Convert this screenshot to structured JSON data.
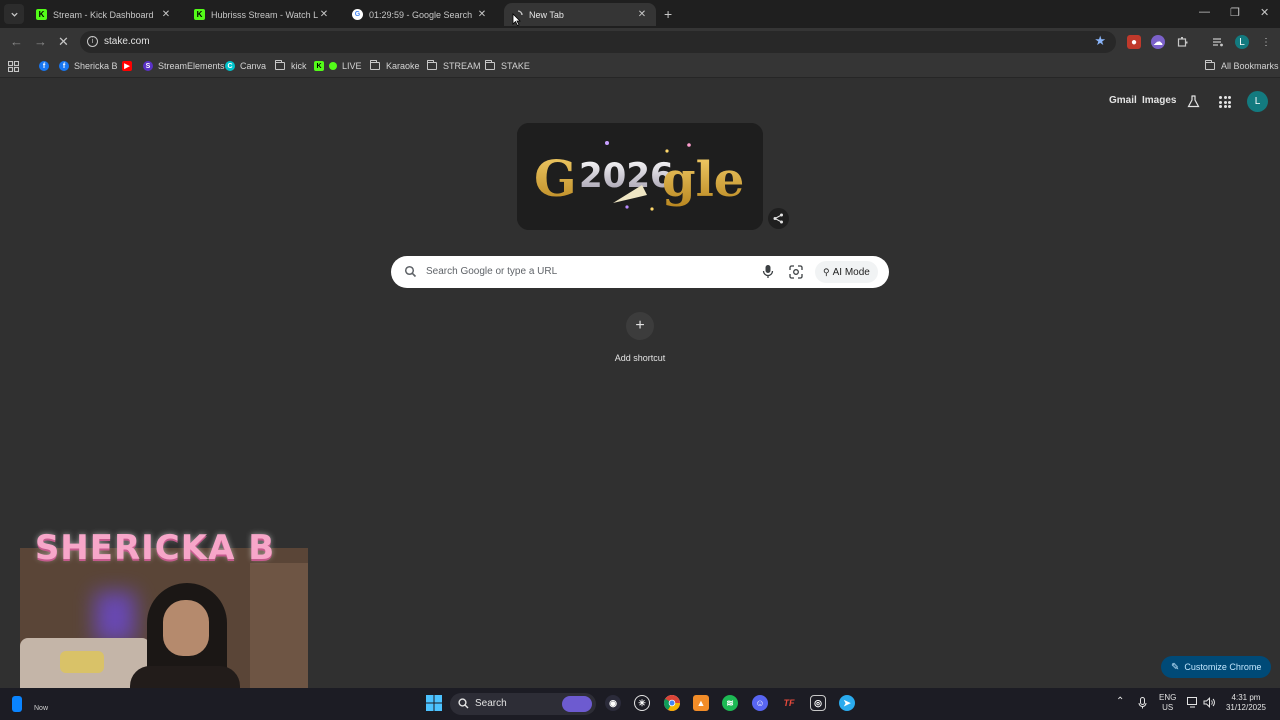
{
  "tabs": [
    {
      "title": "Stream - Kick Dashboard",
      "favicon": "kick-icon"
    },
    {
      "title": "Hubrisss Stream - Watch Live o",
      "favicon": "kick-icon"
    },
    {
      "title": "01:29:59 - Google Search",
      "favicon": "google-icon"
    },
    {
      "title": "New Tab",
      "favicon": "loading-icon",
      "active": true
    }
  ],
  "address_bar": {
    "url": "stake.com"
  },
  "bookmarks": {
    "items": [
      {
        "label": "Shericka B",
        "icon": "facebook-icon"
      },
      {
        "label": "",
        "icon": "youtube-icon"
      },
      {
        "label": "StreamElements",
        "icon": "streamelements-icon"
      },
      {
        "label": "Canva",
        "icon": "canva-icon"
      },
      {
        "label": "kick",
        "icon": "folder-icon"
      },
      {
        "label": "LIVE",
        "icon": "kick-icon"
      },
      {
        "label": "Karaoke",
        "icon": "folder-icon"
      },
      {
        "label": "STREAM",
        "icon": "folder-icon"
      },
      {
        "label": "STAKE",
        "icon": "folder-icon"
      }
    ],
    "all_bookmarks": "All Bookmarks"
  },
  "header_links": {
    "gmail": "Gmail",
    "images": "Images",
    "avatar_letter": "L"
  },
  "search": {
    "placeholder": "Search Google or type a URL",
    "ai_mode": "AI Mode"
  },
  "shortcuts": {
    "add_label": "Add shortcut"
  },
  "customize": {
    "label": "Customize Chrome"
  },
  "doodle": {
    "text": "Google 2026",
    "year": "2026"
  },
  "webcam": {
    "name": "SHERICKA B"
  },
  "taskbar": {
    "search_label": "Search",
    "now_label": "Now",
    "lang_top": "ENG",
    "lang_bottom": "US",
    "time": "4:31 pm",
    "date": "31/12/2025"
  },
  "colors": {
    "accent": "#8ab4f8",
    "kick": "#53fc18",
    "customize_bg": "#004a77"
  }
}
